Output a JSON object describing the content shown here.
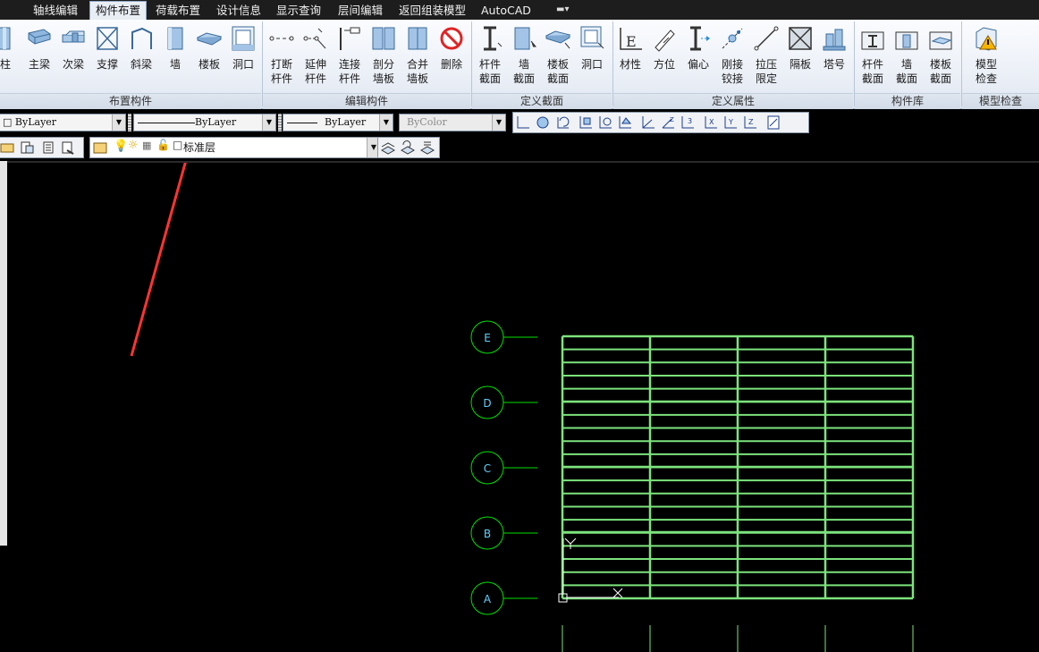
{
  "menu": {
    "tabs": [
      "轴线编辑",
      "构件布置",
      "荷载布置",
      "设计信息",
      "显示查询",
      "层间编辑",
      "返回组装模型",
      "AutoCAD"
    ],
    "active_index": 1
  },
  "ribbon": {
    "groups": [
      "布置构件",
      "编辑构件",
      "定义截面",
      "定义属性",
      "构件库",
      "模型检查"
    ],
    "buttons": {
      "col": "柱",
      "beam": "主梁",
      "sec_beam": "次梁",
      "brace": "支撑",
      "slant_beam": "斜梁",
      "wall": "墙",
      "slab": "楼板",
      "opening": "洞口",
      "break_1": "打断",
      "break_2": "杆件",
      "extend_1": "延伸",
      "extend_2": "杆件",
      "connect_1": "连接",
      "connect_2": "杆件",
      "split_1": "剖分",
      "split_2": "墙板",
      "merge_1": "合并",
      "merge_2": "墙板",
      "delete": "删除",
      "def_member_1": "杆件",
      "def_member_2": "截面",
      "def_wall_1": "墙",
      "def_wall_2": "截面",
      "def_slab_1": "楼板",
      "def_slab_2": "截面",
      "def_opening": "洞口",
      "material": "材性",
      "orientation": "方位",
      "eccentric": "偏心",
      "hinge_1": "刚接",
      "hinge_2": "铰接",
      "tension_1": "拉压",
      "tension_2": "限定",
      "diaphragm": "隔板",
      "tower": "塔号",
      "lib_member_1": "杆件",
      "lib_member_2": "截面",
      "lib_wall_1": "墙",
      "lib_wall_2": "截面",
      "lib_slab_1": "楼板",
      "lib_slab_2": "截面",
      "check_1": "模型",
      "check_2": "检查"
    }
  },
  "toolbar": {
    "layer_combo": "ByLayer",
    "linetype_combo": "ByLayer",
    "lineweight_combo": "ByLayer",
    "color_combo": "ByColor",
    "current_layer": "标准层"
  },
  "drawing": {
    "axis_labels": [
      "E",
      "D",
      "C",
      "B",
      "A"
    ],
    "colors": {
      "grid": "#7de37d",
      "bubble": "#00e000",
      "bubble_text": "#5fd0ff",
      "arrow": "#ff3333",
      "background": "#000000"
    }
  }
}
